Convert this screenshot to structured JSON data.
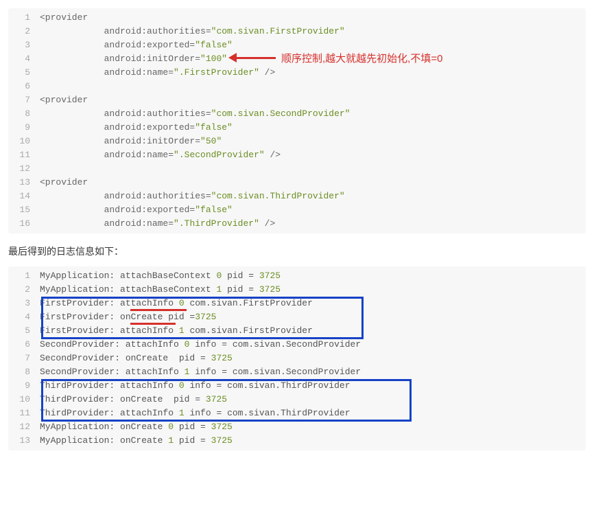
{
  "block1": {
    "lines": [
      {
        "n": "1",
        "tokens": [
          {
            "t": "<provider",
            "c": "tag"
          }
        ]
      },
      {
        "n": "2",
        "tokens": [
          {
            "t": "            android:authorities=",
            "c": "attr"
          },
          {
            "t": "\"com.sivan.FirstProvider\"",
            "c": "str"
          }
        ]
      },
      {
        "n": "3",
        "tokens": [
          {
            "t": "            android:exported=",
            "c": "attr"
          },
          {
            "t": "\"false\"",
            "c": "str"
          }
        ]
      },
      {
        "n": "4",
        "tokens": [
          {
            "t": "            android:initOrder=",
            "c": "attr"
          },
          {
            "t": "\"100\"",
            "c": "str"
          }
        ]
      },
      {
        "n": "5",
        "tokens": [
          {
            "t": "            android:name=",
            "c": "attr"
          },
          {
            "t": "\".FirstProvider\"",
            "c": "str"
          },
          {
            "t": " />",
            "c": "tag"
          }
        ]
      },
      {
        "n": "6",
        "tokens": [
          {
            "t": "",
            "c": ""
          }
        ]
      },
      {
        "n": "7",
        "tokens": [
          {
            "t": "<provider",
            "c": "tag"
          }
        ]
      },
      {
        "n": "8",
        "tokens": [
          {
            "t": "            android:authorities=",
            "c": "attr"
          },
          {
            "t": "\"com.sivan.SecondProvider\"",
            "c": "str"
          }
        ]
      },
      {
        "n": "9",
        "tokens": [
          {
            "t": "            android:exported=",
            "c": "attr"
          },
          {
            "t": "\"false\"",
            "c": "str"
          }
        ]
      },
      {
        "n": "10",
        "tokens": [
          {
            "t": "            android:initOrder=",
            "c": "attr"
          },
          {
            "t": "\"50\"",
            "c": "str"
          }
        ]
      },
      {
        "n": "11",
        "tokens": [
          {
            "t": "            android:name=",
            "c": "attr"
          },
          {
            "t": "\".SecondProvider\"",
            "c": "str"
          },
          {
            "t": " />",
            "c": "tag"
          }
        ]
      },
      {
        "n": "12",
        "tokens": [
          {
            "t": "",
            "c": ""
          }
        ]
      },
      {
        "n": "13",
        "tokens": [
          {
            "t": "<provider",
            "c": "tag"
          }
        ]
      },
      {
        "n": "14",
        "tokens": [
          {
            "t": "            android:authorities=",
            "c": "attr"
          },
          {
            "t": "\"com.sivan.ThirdProvider\"",
            "c": "str"
          }
        ]
      },
      {
        "n": "15",
        "tokens": [
          {
            "t": "            android:exported=",
            "c": "attr"
          },
          {
            "t": "\"false\"",
            "c": "str"
          }
        ]
      },
      {
        "n": "16",
        "tokens": [
          {
            "t": "            android:name=",
            "c": "attr"
          },
          {
            "t": "\".ThirdProvider\"",
            "c": "str"
          },
          {
            "t": " />",
            "c": "tag"
          }
        ]
      }
    ]
  },
  "annotation": "顺序控制,越大就越先初始化,不填=0",
  "caption": "最后得到的日志信息如下：",
  "block2": {
    "lines": [
      {
        "n": "1",
        "tokens": [
          {
            "t": "MyApplication: attachBaseContext ",
            "c": "log-class"
          },
          {
            "t": "0",
            "c": "log-pid"
          },
          {
            "t": " pid = ",
            "c": "log-class"
          },
          {
            "t": "3725",
            "c": "log-pid"
          }
        ]
      },
      {
        "n": "2",
        "tokens": [
          {
            "t": "MyApplication: attachBaseContext ",
            "c": "log-class"
          },
          {
            "t": "1",
            "c": "log-pid"
          },
          {
            "t": " pid = ",
            "c": "log-class"
          },
          {
            "t": "3725",
            "c": "log-pid"
          }
        ]
      },
      {
        "n": "3",
        "tokens": [
          {
            "t": "FirstProvider: attachInfo ",
            "c": "log-class"
          },
          {
            "t": "0",
            "c": "log-pid"
          },
          {
            "t": " com.sivan.FirstProvider",
            "c": "log-class"
          }
        ]
      },
      {
        "n": "4",
        "tokens": [
          {
            "t": "FirstProvider: onCreate pid =",
            "c": "log-class"
          },
          {
            "t": "3725",
            "c": "log-pid"
          }
        ]
      },
      {
        "n": "5",
        "tokens": [
          {
            "t": "FirstProvider: attachInfo ",
            "c": "log-class"
          },
          {
            "t": "1",
            "c": "log-pid"
          },
          {
            "t": " com.sivan.FirstProvider",
            "c": "log-class"
          }
        ]
      },
      {
        "n": "6",
        "tokens": [
          {
            "t": "SecondProvider: attachInfo ",
            "c": "log-class"
          },
          {
            "t": "0",
            "c": "log-pid"
          },
          {
            "t": " info = com.sivan.SecondProvider",
            "c": "log-class"
          }
        ]
      },
      {
        "n": "7",
        "tokens": [
          {
            "t": "SecondProvider: onCreate  pid = ",
            "c": "log-class"
          },
          {
            "t": "3725",
            "c": "log-pid"
          }
        ]
      },
      {
        "n": "8",
        "tokens": [
          {
            "t": "SecondProvider: attachInfo ",
            "c": "log-class"
          },
          {
            "t": "1",
            "c": "log-pid"
          },
          {
            "t": " info = com.sivan.SecondProvider",
            "c": "log-class"
          }
        ]
      },
      {
        "n": "9",
        "tokens": [
          {
            "t": "ThirdProvider: attachInfo ",
            "c": "log-class"
          },
          {
            "t": "0",
            "c": "log-pid"
          },
          {
            "t": " info = com.sivan.ThirdProvider",
            "c": "log-class"
          }
        ]
      },
      {
        "n": "10",
        "tokens": [
          {
            "t": "ThirdProvider: onCreate  pid = ",
            "c": "log-class"
          },
          {
            "t": "3725",
            "c": "log-pid"
          }
        ]
      },
      {
        "n": "11",
        "tokens": [
          {
            "t": "ThirdProvider: attachInfo ",
            "c": "log-class"
          },
          {
            "t": "1",
            "c": "log-pid"
          },
          {
            "t": " info = com.sivan.ThirdProvider",
            "c": "log-class"
          }
        ]
      },
      {
        "n": "12",
        "tokens": [
          {
            "t": "MyApplication: onCreate ",
            "c": "log-class"
          },
          {
            "t": "0",
            "c": "log-pid"
          },
          {
            "t": " pid = ",
            "c": "log-class"
          },
          {
            "t": "3725",
            "c": "log-pid"
          }
        ]
      },
      {
        "n": "13",
        "tokens": [
          {
            "t": "MyApplication: onCreate ",
            "c": "log-class"
          },
          {
            "t": "1",
            "c": "log-pid"
          },
          {
            "t": " pid = ",
            "c": "log-class"
          },
          {
            "t": "3725",
            "c": "log-pid"
          }
        ]
      }
    ]
  }
}
